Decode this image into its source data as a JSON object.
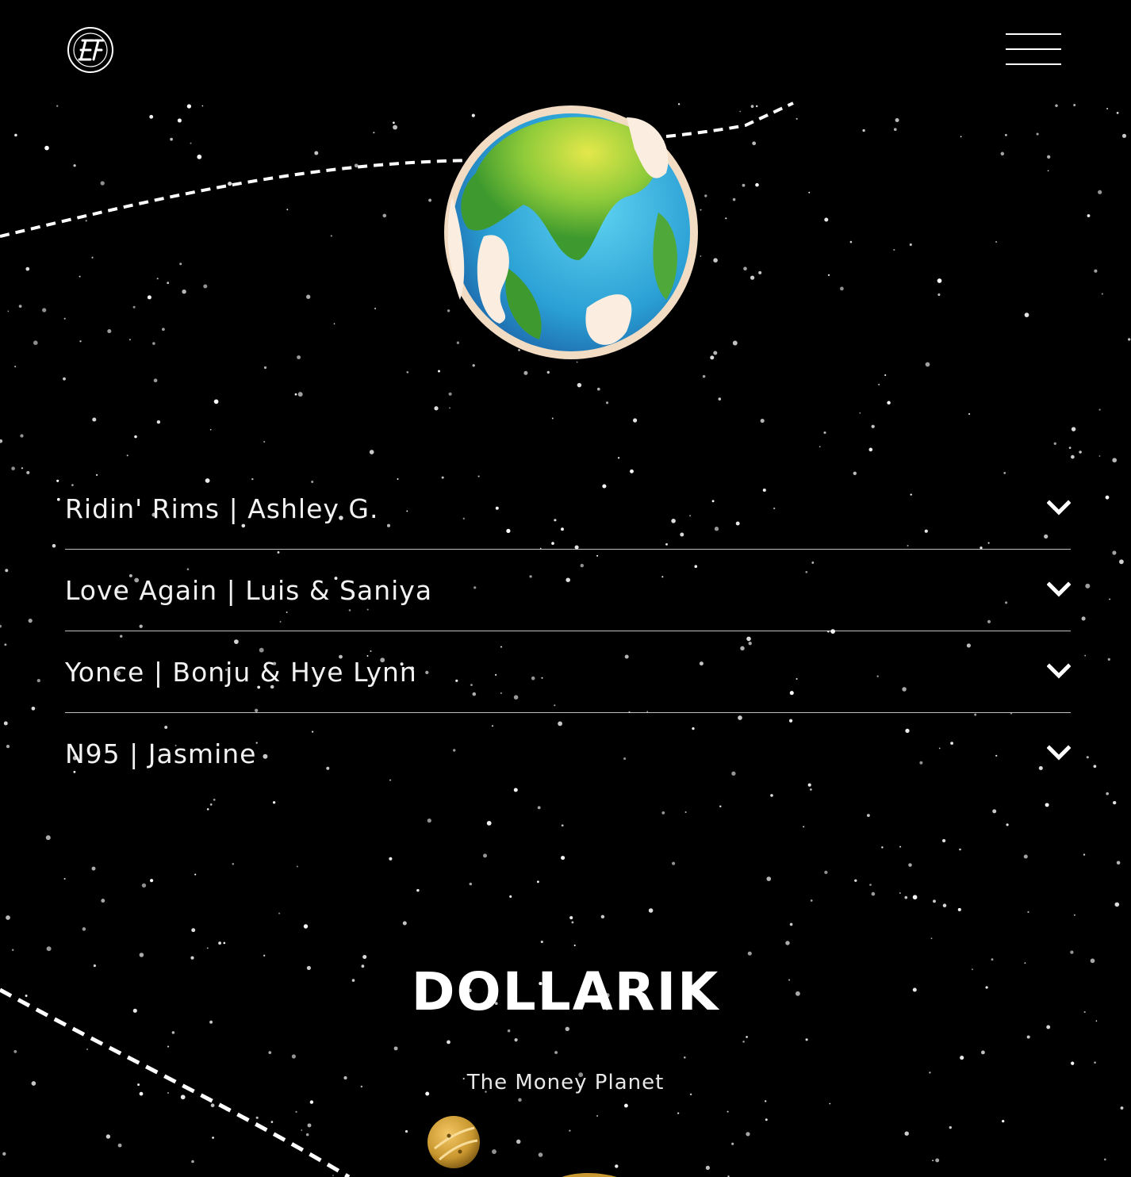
{
  "header": {
    "logo_icon": "ef-circle-logo-icon",
    "menu_icon": "hamburger-menu-icon"
  },
  "planet_image": "cartoon-earth-planet",
  "accordion": {
    "items": [
      {
        "label": "Ridin' Rims | Ashley G.",
        "icon": "chevron-down-icon"
      },
      {
        "label": "Love Again | Luis & Saniya",
        "icon": "chevron-down-icon"
      },
      {
        "label": "Yonce | Bonju & Hye Lynn",
        "icon": "chevron-down-icon"
      },
      {
        "label": "N95 | Jasmine",
        "icon": "chevron-down-icon"
      }
    ]
  },
  "dollarik": {
    "title": "DOLLARIK",
    "subtitle": "The Money Planet",
    "coin_image": "gold-coin-planet"
  },
  "colors": {
    "background": "#000000",
    "text": "#ffffff",
    "accent_gold": "#c9972f",
    "earth_green": "#7cc23b",
    "earth_blue": "#2fa6d6"
  }
}
